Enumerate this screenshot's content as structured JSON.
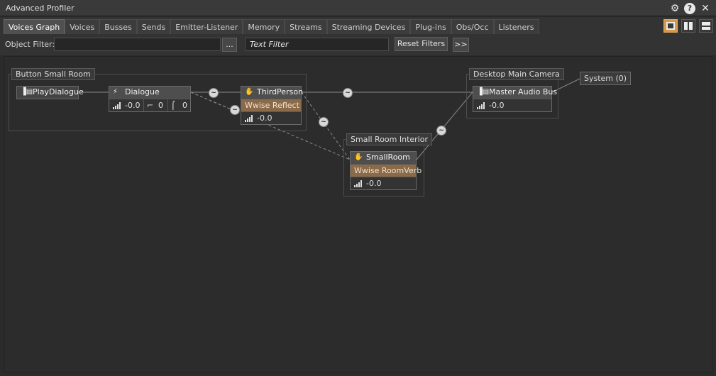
{
  "window": {
    "title": "Advanced Profiler"
  },
  "titlebar_icons": [
    "gear-icon",
    "help-icon",
    "close-icon"
  ],
  "tabs": [
    {
      "label": "Voices Graph",
      "active": true
    },
    {
      "label": "Voices"
    },
    {
      "label": "Busses"
    },
    {
      "label": "Sends"
    },
    {
      "label": "Emitter-Listener"
    },
    {
      "label": "Memory"
    },
    {
      "label": "Streams"
    },
    {
      "label": "Streaming Devices"
    },
    {
      "label": "Plug-ins"
    },
    {
      "label": "Obs/Occ"
    },
    {
      "label": "Listeners"
    }
  ],
  "filter": {
    "object_label": "Object Filter:",
    "object_value": "",
    "browse_label": "...",
    "text_placeholder": "Text Filter",
    "reset_label": "Reset Filters",
    "expand_label": ">>"
  },
  "graph": {
    "groups": {
      "button_small_room": "Button Small Room",
      "small_room_interior": "Small Room Interior",
      "desktop_main_camera": "Desktop Main Camera"
    },
    "nodes": {
      "play_dialogue": {
        "label": "PlayDialogue"
      },
      "dialogue": {
        "label": "Dialogue",
        "volume": "-0.0",
        "lpf": "0",
        "hpf": "0"
      },
      "third_person": {
        "label": "ThirdPerson",
        "effect": "Wwise Reflect",
        "volume": "-0.0"
      },
      "small_room": {
        "label": "SmallRoom",
        "effect": "Wwise RoomVerb",
        "volume": "-0.0"
      },
      "master_audio_bus": {
        "label": "Master Audio Bus",
        "volume": "-0.0"
      },
      "system": {
        "label": "System (0)"
      }
    },
    "connector_symbol": "~",
    "colors": {
      "effect_row": "#8a6a48",
      "active_view": "#d49a4a"
    }
  }
}
